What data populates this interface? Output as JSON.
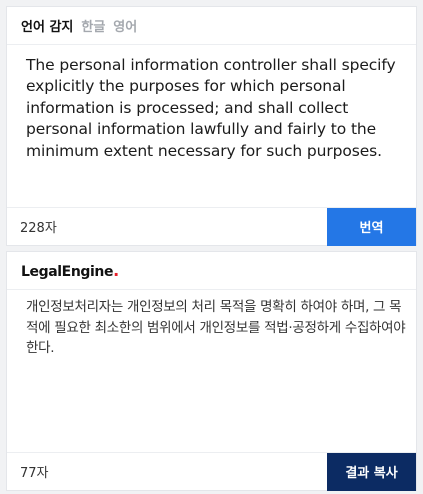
{
  "source_panel": {
    "tabs": [
      {
        "label": "언어 감지",
        "active": true
      },
      {
        "label": "한글",
        "active": false
      },
      {
        "label": "영어",
        "active": false
      }
    ],
    "text": "The personal information controller shall specify explicitly the purposes for which personal information is processed; and shall collect personal information lawfully and fairly to the minimum extent necessary for such purposes.",
    "char_count": "228자",
    "translate_label": "번역"
  },
  "result_panel": {
    "brand": "LegalEngine",
    "brand_dot": ".",
    "text": "개인정보처리자는 개인정보의 처리 목적을 명확히 하여야 하며, 그 목적에 필요한 최소한의 범위에서 개인정보를 적법·공정하게 수집하여야 한다.",
    "char_count": "77자",
    "copy_label": "결과 복사"
  },
  "colors": {
    "translate_button": "#2477e6",
    "copy_button": "#0c2b63",
    "brand_dot": "#e8202a"
  }
}
